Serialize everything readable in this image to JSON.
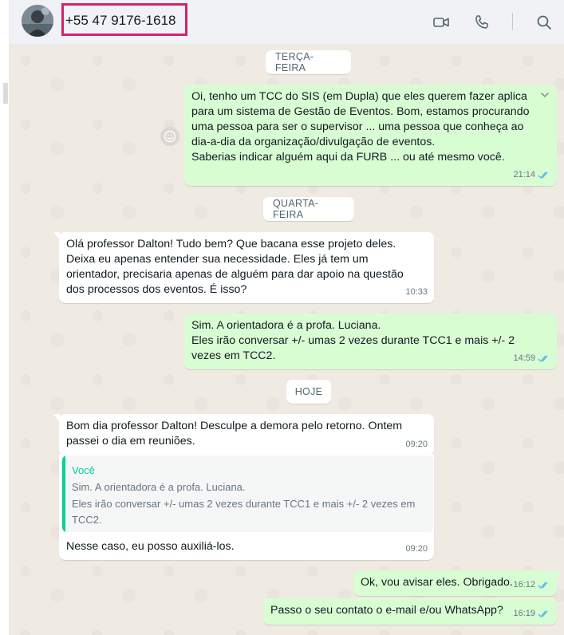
{
  "header": {
    "contact": "+55 47 9176-1618",
    "icons": [
      "video-call-icon",
      "voice-call-icon",
      "search-icon"
    ]
  },
  "colors": {
    "outgoing_bubble": "#d9fdd3",
    "incoming_bubble": "#ffffff",
    "chat_background": "#efeae2",
    "read_ticks": "#53bdeb",
    "quote_accent": "#06cf9c",
    "highlight_box": "#d6216b"
  },
  "dates": {
    "tuesday": "TERÇA-FEIRA",
    "wednesday": "QUARTA-FEIRA",
    "today": "HOJE"
  },
  "messages": {
    "m1": {
      "text": "Oi, tenho um TCC do SIS (em Dupla) que eles querem fazer aplica\npara um sistema de Gestão de Eventos. Bom, estamos procurando\numa pessoa para ser o supervisor ... uma pessoa que conheça ao\ndia-a-dia da organização/divulgação de eventos.\nSaberias indicar alguém aqui da FURB ... ou até mesmo você.",
      "time": "21:14"
    },
    "m2": {
      "text": "Olá professor Dalton! Tudo bem? Que bacana esse projeto deles.\nDeixa eu apenas entender sua necessidade. Eles já tem um\norientador, precisaria apenas de alguém para dar apoio na questão\ndos processos dos eventos. É isso?",
      "time": "10:33"
    },
    "m3": {
      "text": "Sim. A orientadora é a profa. Luciana.\nEles irão conversar +/- umas 2 vezes durante TCC1 e mais +/- 2\nvezes em TCC2.",
      "time": "14:59"
    },
    "m4": {
      "text": "Bom dia professor Dalton! Desculpe a demora pelo retorno. Ontem\npassei o dia em reuniões.",
      "time": "09:20"
    },
    "m5": {
      "quote_author": "Você",
      "quote_text": "Sim. A orientadora é a profa. Luciana.\nEles irão conversar +/- umas 2 vezes durante TCC1 e mais +/- 2 vezes em\nTCC2.",
      "text": "Nesse caso, eu posso auxiliá-los.",
      "time": "09:20"
    },
    "m6": {
      "text": "Ok, vou avisar eles. Obrigado.",
      "time": "16:12"
    },
    "m7": {
      "text": "Passo o seu contato o e-mail e/ou WhatsApp?",
      "time": "16:19"
    }
  }
}
